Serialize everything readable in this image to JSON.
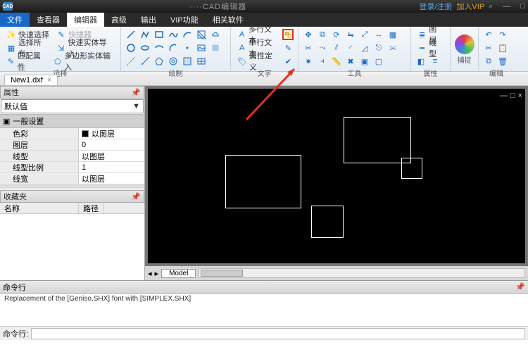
{
  "titlebar": {
    "app_badge": "CAD",
    "title": "····CAD编辑器",
    "login": "登录/注册",
    "vip": "加入VIP",
    "search_glyph": "⌕",
    "min": "—",
    "max": "□"
  },
  "menu": {
    "tabs": [
      "文件",
      "查看器",
      "编辑器",
      "高级",
      "输出",
      "VIP功能",
      "相关软件"
    ],
    "active": 0,
    "selected": 2
  },
  "ribbon": {
    "select": {
      "quick": "快速选择",
      "quick2": "快捷器",
      "all": "选择所有",
      "import": "快速实体导入",
      "match": "匹配属性",
      "poly": "多边形实体输入",
      "label": "选择"
    },
    "draw": {
      "label": "绘制"
    },
    "text": {
      "multi": "多行文本",
      "single": "单行文本",
      "attr": "属性定义",
      "label": "文字"
    },
    "tools": {
      "label": "工具"
    },
    "props": {
      "layer": "图层",
      "linetype": "线型",
      "label": "属性"
    },
    "capture": {
      "label": "捕捉"
    },
    "edit": {
      "label": "编辑"
    }
  },
  "file_tab": {
    "name": "New1.dxf",
    "close": "×"
  },
  "left": {
    "props_title": "属性",
    "combo": "默认值",
    "cat": "一般设置",
    "rows": [
      {
        "k": "色彩",
        "v": "以图层",
        "swatch": true
      },
      {
        "k": "图层",
        "v": "0"
      },
      {
        "k": "线型",
        "v": "以图层"
      },
      {
        "k": "线型比例",
        "v": "1"
      },
      {
        "k": "线宽",
        "v": "以图层"
      }
    ],
    "fav_title": "收藏夹",
    "fav_cols": {
      "name": "名称",
      "path": "路径"
    },
    "pin": "📌"
  },
  "canvas": {
    "model_tab": "Model",
    "nav_left": "◂",
    "nav_right": "▸",
    "win_min": "—",
    "win_max": "□",
    "win_close": "×"
  },
  "cmd": {
    "title": "命令行",
    "body": "Replacement of the [Geniso.SHX] font with [SIMPLEX.SHX]",
    "prompt": "命令行:",
    "pin": "📌"
  },
  "chart_data": {
    "type": "table",
    "title": "属性 — 一般设置",
    "rows": [
      {
        "属性": "色彩",
        "值": "以图层"
      },
      {
        "属性": "图层",
        "值": "0"
      },
      {
        "属性": "线型",
        "值": "以图层"
      },
      {
        "属性": "线型比例",
        "值": "1"
      },
      {
        "属性": "线宽",
        "值": "以图层"
      }
    ]
  }
}
